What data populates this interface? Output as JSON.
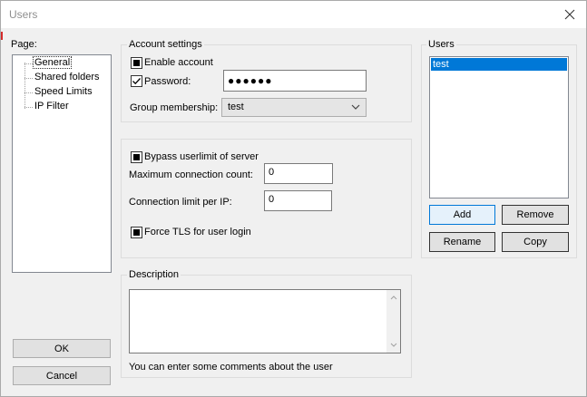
{
  "window": {
    "title": "Users",
    "close_icon": "close-icon"
  },
  "page_panel": {
    "label": "Page:",
    "items": [
      {
        "label": "General",
        "selected": true
      },
      {
        "label": "Shared folders"
      },
      {
        "label": "Speed Limits"
      },
      {
        "label": "IP Filter"
      }
    ]
  },
  "account_settings": {
    "title": "Account settings",
    "enable_account_label": "Enable account",
    "enable_account_checked": true,
    "password_label": "Password:",
    "password_checked": true,
    "password_value": "●●●●●●",
    "group_membership_label": "Group membership:",
    "group_membership_value": "test"
  },
  "limits": {
    "bypass_label": "Bypass userlimit of server",
    "bypass_checked": true,
    "max_connection_label": "Maximum connection count:",
    "max_connection_value": "0",
    "connection_limit_ip_label": "Connection limit per IP:",
    "connection_limit_ip_value": "0",
    "force_tls_label": "Force TLS for user login",
    "force_tls_checked": true
  },
  "description": {
    "title": "Description",
    "value": "",
    "hint": "You can enter some comments about the user"
  },
  "users_panel": {
    "title": "Users",
    "users": [
      {
        "name": "test",
        "selected": true
      }
    ],
    "add_label": "Add",
    "remove_label": "Remove",
    "rename_label": "Rename",
    "copy_label": "Copy"
  },
  "dialog_buttons": {
    "ok_label": "OK",
    "cancel_label": "Cancel"
  },
  "colors": {
    "selection": "#0078d7",
    "window_bg": "#f0f0f0",
    "title_text": "#8f8f8f"
  }
}
